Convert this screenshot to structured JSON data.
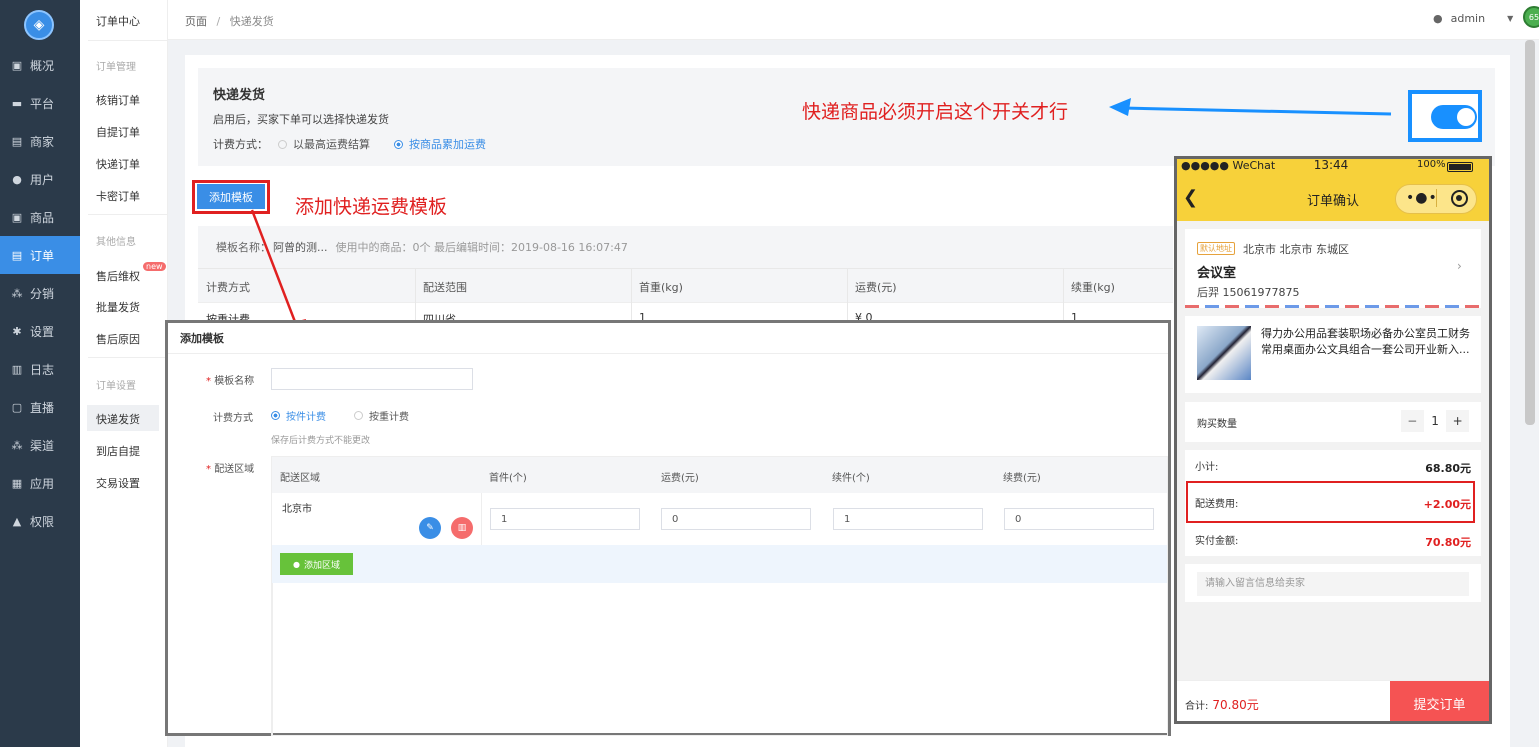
{
  "nav": {
    "items": [
      {
        "label": "概况",
        "icon": "dashboard-icon",
        "glyph": "▣"
      },
      {
        "label": "平台",
        "icon": "monitor-icon",
        "glyph": "▬"
      },
      {
        "label": "商家",
        "icon": "shop-icon",
        "glyph": "▤"
      },
      {
        "label": "用户",
        "icon": "user-icon",
        "glyph": "●"
      },
      {
        "label": "商品",
        "icon": "goods-icon",
        "glyph": "▣"
      },
      {
        "label": "订单",
        "icon": "order-icon",
        "glyph": "▤"
      },
      {
        "label": "分销",
        "icon": "share-icon",
        "glyph": "⁂"
      },
      {
        "label": "设置",
        "icon": "gear-icon",
        "glyph": "✱"
      },
      {
        "label": "日志",
        "icon": "log-icon",
        "glyph": "▥"
      },
      {
        "label": "直播",
        "icon": "live-icon",
        "glyph": "▢"
      },
      {
        "label": "渠道",
        "icon": "channel-icon",
        "glyph": "⁂"
      },
      {
        "label": "应用",
        "icon": "apps-icon",
        "glyph": "▦"
      },
      {
        "label": "权限",
        "icon": "lock-icon",
        "glyph": "▲"
      }
    ]
  },
  "subnav": {
    "title": "订单中心",
    "sec1": "订单管理",
    "items1": [
      "核销订单",
      "自提订单",
      "快递订单",
      "卡密订单"
    ],
    "sec2": "其他信息",
    "items2": [
      "售后维权",
      "批量发货",
      "售后原因"
    ],
    "badge": "new",
    "sec3": "订单设置",
    "items3": [
      "快递发货",
      "到店自提",
      "交易设置"
    ]
  },
  "header": {
    "crumb1": "页面",
    "sep": "/",
    "crumb2": "快递发货",
    "user": "admin",
    "badge": "65"
  },
  "express": {
    "title": "快递发货",
    "desc": "启用后，买家下单可以选择快递发货",
    "fee_label": "计费方式：",
    "opt1": "以最高运费结算",
    "opt2": "按商品累加运费",
    "toggle_on": true
  },
  "annot": {
    "toggle_note": "快递商品必须开启这个开关才行",
    "add_note": "添加快递运费模板"
  },
  "add_template_btn": "添加模板",
  "template": {
    "name_label": "模板名称",
    "name_value": "阿曾的测...",
    "meta": "使用中的商品：0个  最后编辑时间：2019-08-16 16:07:47",
    "headers": [
      "计费方式",
      "配送范围",
      "首重(kg)",
      "运费(元)",
      "续重(kg)"
    ],
    "row": [
      "按重计费",
      "四川省",
      "1",
      "¥ 0",
      "1"
    ]
  },
  "dialog": {
    "title": "添加模板",
    "name_label": "模板名称",
    "fee_label": "计费方式",
    "opt1": "按件计费",
    "opt2": "按重计费",
    "hint": "保存后计费方式不能更改",
    "area_label": "配送区域",
    "headers": [
      "配送区域",
      "首件(个)",
      "运费(元)",
      "续件(个)",
      "续费(元)"
    ],
    "region": "北京市",
    "values": [
      "1",
      "0",
      "1",
      "0"
    ],
    "add_area": "添加区域"
  },
  "phone": {
    "carrier": "●●●●● WeChat",
    "time": "13:44",
    "battery": "100%",
    "title": "订单确认",
    "default_tag": "默认地址",
    "address": "北京市 北京市 东城区",
    "place": "会议室",
    "contact": "后羿  15061977875",
    "product": "得力办公用品套装职场必备办公室员工财务常用桌面办公文具组合一套公司开业新入...",
    "qty_label": "购买数量",
    "qty": "1",
    "minus": "−",
    "plus": "+",
    "subtotal_label": "小计:",
    "subtotal": "68.80元",
    "shipping_label": "配送费用:",
    "shipping": "+2.00元",
    "paid_label": "实付金额:",
    "paid": "70.80元",
    "msg_placeholder": "请输入留言信息给卖家",
    "total_label": "合计:",
    "total": "70.80元",
    "submit": "提交订单"
  }
}
